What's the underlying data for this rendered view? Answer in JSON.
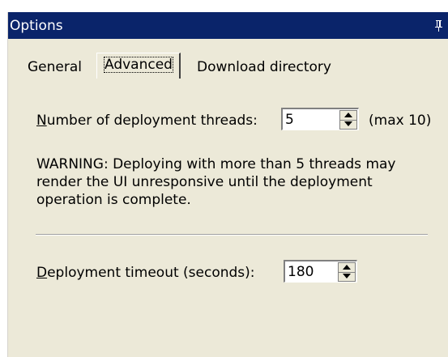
{
  "window": {
    "title": "Options",
    "pin_icon": "pushpin-icon"
  },
  "tabs": [
    {
      "label": "General",
      "active": false
    },
    {
      "label": "Advanced",
      "active": true
    },
    {
      "label": "Download directory",
      "active": false
    }
  ],
  "advanced": {
    "threads_label_mnemonic": "N",
    "threads_label_rest": "umber of deployment threads:",
    "threads_value": "5",
    "threads_max": "(max 10)",
    "warning": "WARNING: Deploying with more than 5 threads may render the UI unresponsive until the deployment operation is complete.",
    "timeout_label_mnemonic": "D",
    "timeout_label_rest": "eployment timeout (seconds):",
    "timeout_value": "180"
  },
  "colors": {
    "titlebar": "#0a246a",
    "panel": "#ece9d8"
  }
}
